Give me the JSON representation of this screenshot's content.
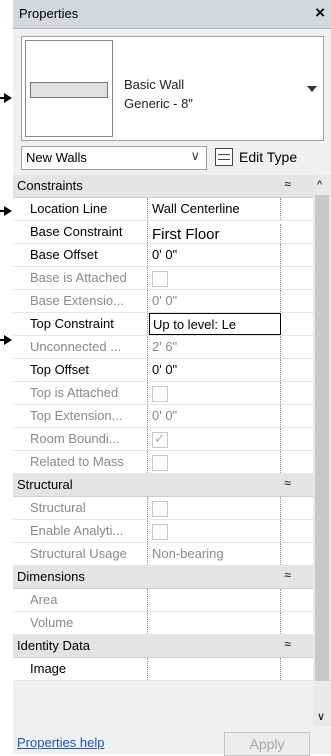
{
  "panel": {
    "title": "Properties",
    "close_glyph": "×",
    "type_selector": {
      "line1": "Basic Wall",
      "line2": "Generic - 8\""
    },
    "filter": {
      "value": "New Walls",
      "chevron": "∨"
    },
    "edit_type_label": "Edit Type"
  },
  "groups": {
    "constraints": "Constraints",
    "structural": "Structural",
    "dimensions": "Dimensions",
    "identity": "Identity Data",
    "collapse_glyph": "≈"
  },
  "props": {
    "location_line": {
      "name": "Location Line",
      "value": "Wall Centerline"
    },
    "base_constraint": {
      "name": "Base Constraint",
      "value": "First Floor"
    },
    "base_offset": {
      "name": "Base Offset",
      "value": "0'  0\""
    },
    "base_attached": {
      "name": "Base is Attached",
      "value": ""
    },
    "base_extension": {
      "name": "Base Extensio...",
      "value": "0'  0\""
    },
    "top_constraint": {
      "name": "Top Constraint",
      "value": "Up to level: Le"
    },
    "unconnected": {
      "name": "Unconnected ...",
      "value": "2'  6\""
    },
    "top_offset": {
      "name": "Top Offset",
      "value": "0'  0\""
    },
    "top_attached": {
      "name": "Top is Attached",
      "value": ""
    },
    "top_extension": {
      "name": "Top Extension...",
      "value": "0'  0\""
    },
    "room_bounding": {
      "name": "Room Boundi...",
      "value": ""
    },
    "related_mass": {
      "name": "Related to Mass",
      "value": ""
    },
    "structural": {
      "name": "Structural",
      "value": ""
    },
    "enable_analytical": {
      "name": "Enable Analyti...",
      "value": ""
    },
    "structural_usage": {
      "name": "Structural Usage",
      "value": "Non-bearing"
    },
    "area": {
      "name": "Area",
      "value": ""
    },
    "volume": {
      "name": "Volume",
      "value": ""
    },
    "image": {
      "name": "Image",
      "value": ""
    }
  },
  "footer": {
    "help_link": "Properties help",
    "apply_label": "Apply"
  },
  "scroll": {
    "up_glyph": "^",
    "down_glyph": "∨"
  },
  "colors": {
    "link": "#1a55c8",
    "header": "#d4d8dd",
    "group": "#e4e4e4"
  }
}
